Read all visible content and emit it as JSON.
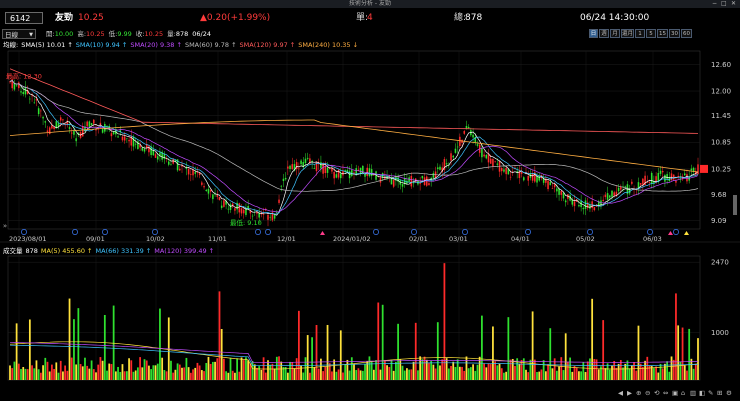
{
  "window": {
    "title": "技術分析 - 友勁",
    "min": "−",
    "max": "□",
    "close": "✕"
  },
  "quote": {
    "code": "6142",
    "name": "友勁",
    "price": "10.25",
    "change": "▲0.20(+1.99%)",
    "unit_label": "單:",
    "unit_value": "4",
    "total_label": "總:",
    "total_value": "878",
    "datetime": "06/24 14:30:00"
  },
  "toolbar": {
    "period_select": "日線",
    "arrow": "▼",
    "ohlc": [
      {
        "label": "開:",
        "value": "10.00",
        "color": "#34e334"
      },
      {
        "label": "高:",
        "value": "10.25",
        "color": "#ff3b3b"
      },
      {
        "label": "低:",
        "value": "9.99",
        "color": "#34e334"
      },
      {
        "label": "收:",
        "value": "10.25",
        "color": "#ff3b3b"
      },
      {
        "label": "量:",
        "value": "878",
        "color": "#ffffff"
      },
      {
        "label": "",
        "value": "06/24",
        "color": "#ffffff"
      }
    ],
    "period_buttons": [
      "日",
      "週",
      "月",
      "還月",
      "1",
      "5",
      "15",
      "30",
      "60"
    ]
  },
  "ma_legend": [
    {
      "text": "均線:",
      "color": "#ffffff"
    },
    {
      "text": "SMA(5) 10.01 ↑",
      "color": "#ffffff"
    },
    {
      "text": "SMA(10) 9.94 ↑",
      "color": "#3fc4ff"
    },
    {
      "text": "SMA(20) 9.38 ↑",
      "color": "#c04cff"
    },
    {
      "text": "SMA(60) 9.78 ↑",
      "color": "#bbbbbb"
    },
    {
      "text": "SMA(120) 9.97 ↑",
      "color": "#ff5a5a"
    },
    {
      "text": "SMA(240) 10.35 ↓",
      "color": "#ffae42"
    }
  ],
  "vol_legend": [
    {
      "text": "成交量",
      "color": "#ffffff"
    },
    {
      "text": "878",
      "color": "#ffffff"
    },
    {
      "text": "MA(5) 455.60 ↑",
      "color": "#ffe23c"
    },
    {
      "text": "MA(66) 331.39 ↑",
      "color": "#3fc4ff"
    },
    {
      "text": "MA(120) 399.49 ↑",
      "color": "#c04cff"
    }
  ],
  "price_axis": [
    "12.60",
    "12.00",
    "11.45",
    "10.85",
    "10.25",
    "9.68",
    "9.09"
  ],
  "volume_axis": [
    "2470",
    "1000"
  ],
  "date_axis": [
    "2023/08/01",
    "09/01",
    "10/02",
    "11/01",
    "12/01",
    "2024/01/02",
    "02/01",
    "03/01",
    "04/01",
    "05/02",
    "06/03"
  ],
  "annotations": {
    "high": "最高: 12.30",
    "low": "最低: 9.10",
    "current": "10.25"
  },
  "scroll": "»",
  "tools": [
    "◀",
    "▶",
    "⊕",
    "⊖",
    "⟲",
    "⇔",
    "▣",
    "⌂",
    "▥",
    "◧",
    "✎",
    "⊞",
    "⚙"
  ],
  "colors": {
    "up": "#ff2a2a",
    "down": "#2fe12f",
    "yellow": "#ffe23c",
    "grid": "#2a2a2a"
  }
}
